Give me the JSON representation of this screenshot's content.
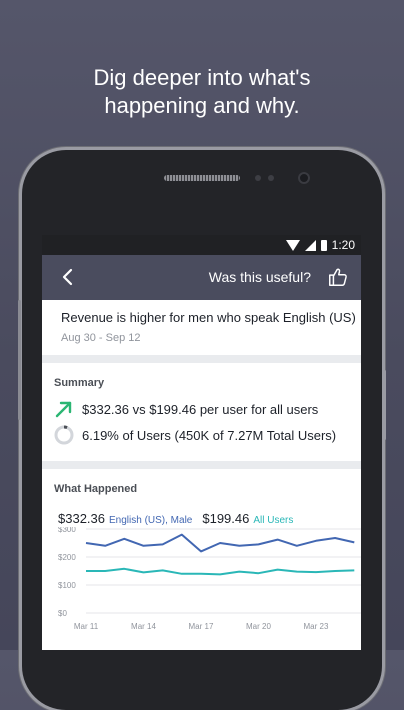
{
  "headline": {
    "line1": "Dig deeper into what's",
    "line2": "happening and why."
  },
  "status_bar": {
    "time": "1:20"
  },
  "app_bar": {
    "useful_label": "Was this useful?"
  },
  "insight": {
    "title": "Revenue is higher for men who speak English (US)",
    "date_range": "Aug 30 - Sep 12"
  },
  "summary": {
    "label": "Summary",
    "line1": "$332.36 vs $199.46 per user for all users",
    "line2": "6.19% of Users (450K of 7.27M Total Users)",
    "share_pct": 6.19
  },
  "what_happened": {
    "label": "What Happened",
    "legend": [
      {
        "value": "$332.36",
        "name": "English (US), Male",
        "color": "#4267b2"
      },
      {
        "value": "$199.46",
        "name": "All Users",
        "color": "#2ab7b7"
      }
    ]
  },
  "colors": {
    "app_bar": "#4a4c5e",
    "up_arrow": "#2bb673",
    "series_primary": "#4267b2",
    "series_secondary": "#2ab7b7"
  },
  "chart_data": {
    "type": "line",
    "x_tick_labels": [
      "Mar 11",
      "Mar 14",
      "Mar 17",
      "Mar 20",
      "Mar 23"
    ],
    "y_tick_labels": [
      "$0",
      "$100",
      "$200",
      "$300"
    ],
    "ylim": [
      0,
      300
    ],
    "grid": true,
    "x": [
      0,
      1,
      2,
      3,
      4,
      5,
      6,
      7,
      8,
      9,
      10,
      11,
      12,
      13,
      14
    ],
    "x_tick_positions": [
      0,
      3,
      6,
      9,
      12
    ],
    "series": [
      {
        "name": "English (US), Male",
        "color": "#4267b2",
        "values": [
          250,
          240,
          265,
          240,
          245,
          280,
          220,
          250,
          240,
          245,
          262,
          240,
          258,
          268,
          252
        ]
      },
      {
        "name": "All Users",
        "color": "#2ab7b7",
        "values": [
          150,
          150,
          158,
          145,
          152,
          140,
          140,
          138,
          148,
          142,
          155,
          148,
          146,
          150,
          152
        ]
      }
    ]
  }
}
